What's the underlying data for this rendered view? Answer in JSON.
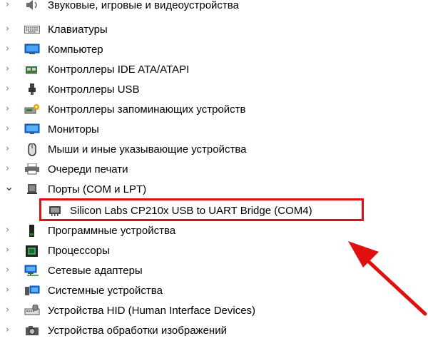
{
  "tree": {
    "items": [
      {
        "label": "Звуковые, игровые и видеоустройства",
        "icon": "speaker-icon",
        "expanded": false
      },
      {
        "label": "Клавиатуры",
        "icon": "keyboard-icon",
        "expanded": false
      },
      {
        "label": "Компьютер",
        "icon": "computer-icon",
        "expanded": false
      },
      {
        "label": "Контроллеры IDE ATA/ATAPI",
        "icon": "ide-controller-icon",
        "expanded": false
      },
      {
        "label": "Контроллеры USB",
        "icon": "usb-icon",
        "expanded": false
      },
      {
        "label": "Контроллеры запоминающих устройств",
        "icon": "storage-controller-icon",
        "expanded": false
      },
      {
        "label": "Мониторы",
        "icon": "monitor-icon",
        "expanded": false
      },
      {
        "label": "Мыши и иные указывающие устройства",
        "icon": "mouse-icon",
        "expanded": false
      },
      {
        "label": "Очереди печати",
        "icon": "printer-icon",
        "expanded": false
      },
      {
        "label": "Порты (COM и LPT)",
        "icon": "port-icon",
        "expanded": true
      },
      {
        "label": "Silicon Labs CP210x USB to UART Bridge (COM4)",
        "icon": "port-icon",
        "child": true
      },
      {
        "label": "Программные устройства",
        "icon": "software-device-icon",
        "expanded": false
      },
      {
        "label": "Процессоры",
        "icon": "processor-icon",
        "expanded": false
      },
      {
        "label": "Сетевые адаптеры",
        "icon": "network-adapter-icon",
        "expanded": false
      },
      {
        "label": "Системные устройства",
        "icon": "system-devices-icon",
        "expanded": false
      },
      {
        "label": "Устройства HID (Human Interface Devices)",
        "icon": "hid-icon",
        "expanded": false
      },
      {
        "label": "Устройства обработки изображений",
        "icon": "camera-icon",
        "expanded": false
      }
    ]
  },
  "colors": {
    "highlight_border": "#e11010",
    "arrow": "#e11010"
  }
}
